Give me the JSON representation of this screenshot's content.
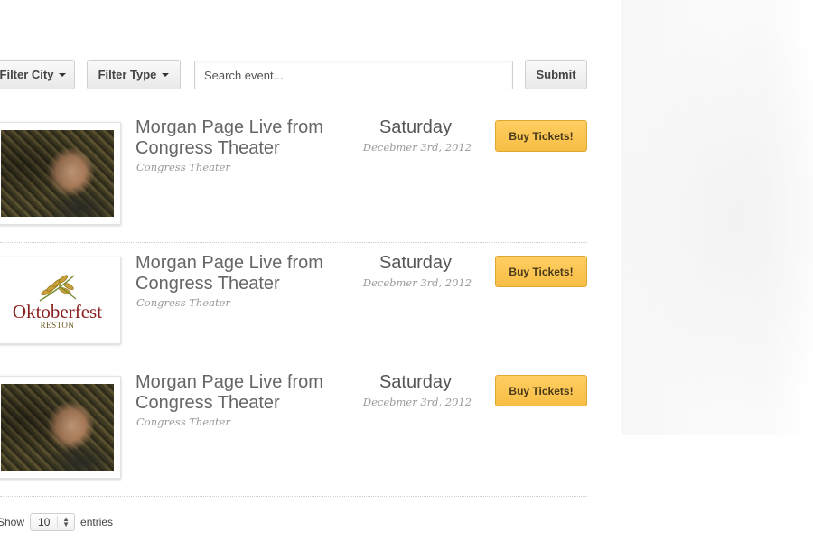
{
  "toolbar": {
    "filter_city_label": "Filter City",
    "filter_type_label": "Filter Type",
    "search_placeholder": "Search event...",
    "submit_label": "Submit"
  },
  "events": [
    {
      "title": "Morgan Page Live from Congress Theater",
      "venue": "Congress Theater",
      "day": "Saturday",
      "date": "Decebmer 3rd, 2012",
      "button_label": "Buy Tickets!",
      "image": "performer-photo"
    },
    {
      "title": "Morgan Page Live from Congress Theater",
      "venue": "Congress Theater",
      "day": "Saturday",
      "date": "Decebmer 3rd, 2012",
      "button_label": "Buy Tickets!",
      "image": "oktoberfest-logo",
      "logo_text": "Oktoberfest",
      "logo_subtext": "RESTON"
    },
    {
      "title": "Morgan Page Live from Congress Theater",
      "venue": "Congress Theater",
      "day": "Saturday",
      "date": "Decebmer 3rd, 2012",
      "button_label": "Buy Tickets!",
      "image": "performer-photo"
    }
  ],
  "pagination": {
    "show_label": "Show",
    "entries_value": "10",
    "entries_label": "entries"
  },
  "colors": {
    "buy_button": "#f7be45",
    "title_text": "#666666",
    "meta_text": "#999999"
  }
}
